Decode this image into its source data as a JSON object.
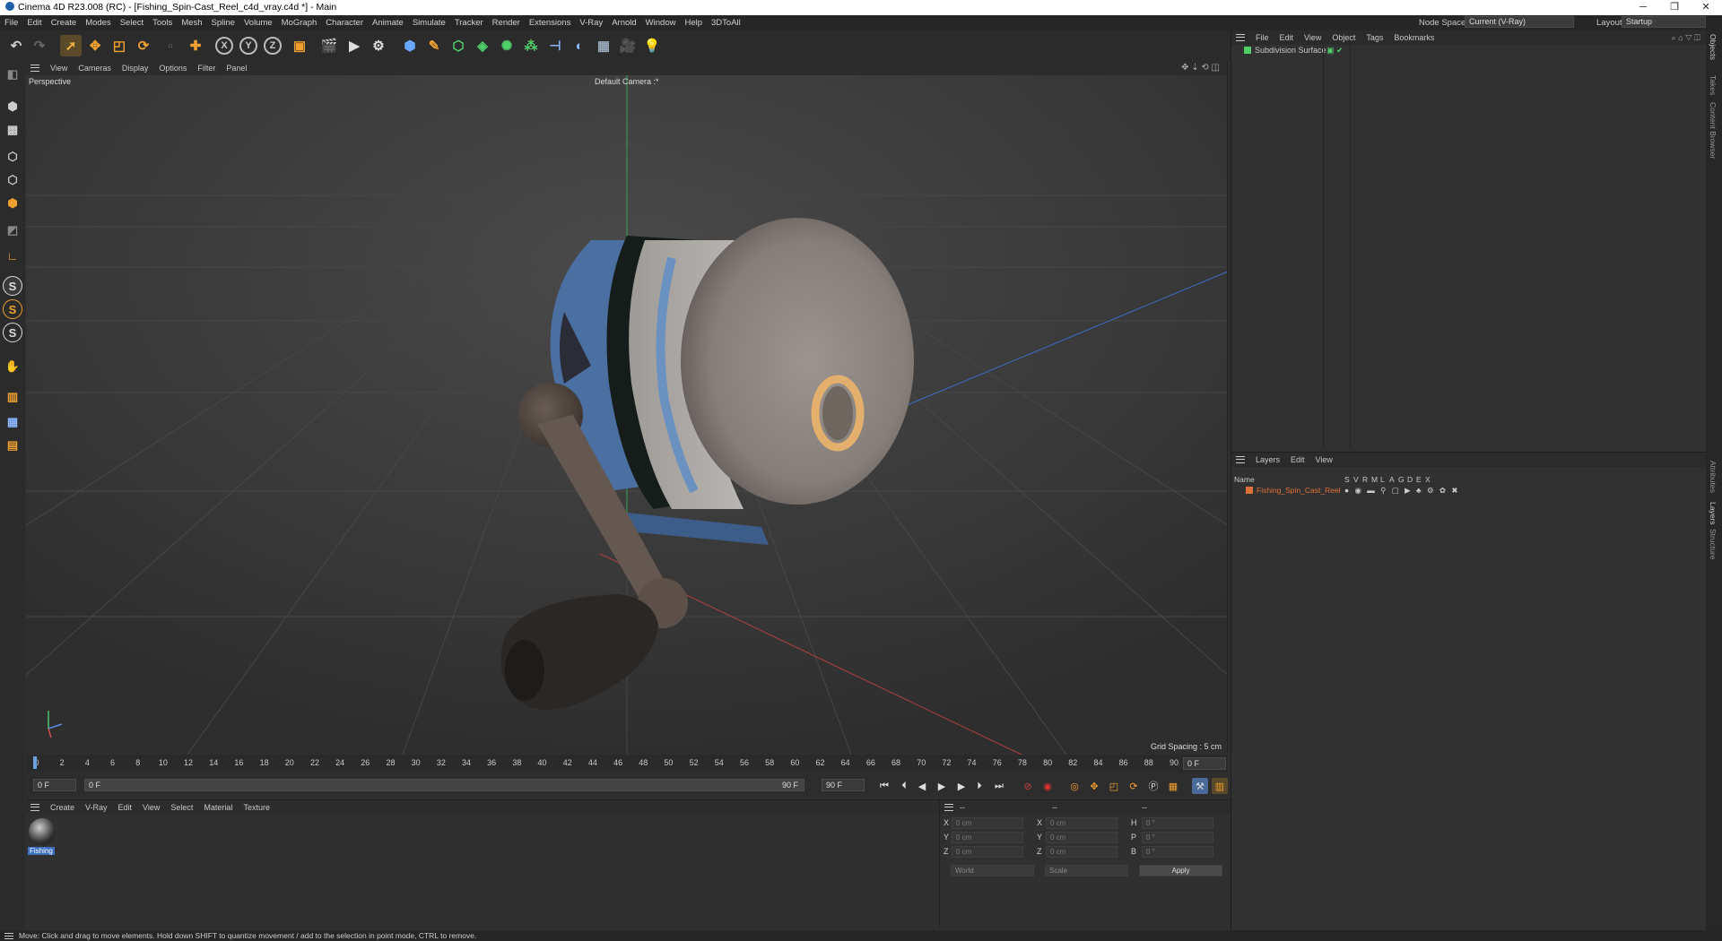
{
  "title": "Cinema 4D R23.008 (RC) - [Fishing_Spin-Cast_Reel_c4d_vray.c4d *] - Main",
  "window_controls": {
    "minimize": "─",
    "restore": "❐",
    "close": "✕"
  },
  "menu": [
    "File",
    "Edit",
    "Create",
    "Modes",
    "Select",
    "Tools",
    "Mesh",
    "Spline",
    "Volume",
    "MoGraph",
    "Character",
    "Animate",
    "Simulate",
    "Tracker",
    "Render",
    "Extensions",
    "V-Ray",
    "Arnold",
    "Window",
    "Help",
    "3DToAll"
  ],
  "node_space": {
    "label": "Node Space:",
    "value": "Current (V-Ray)"
  },
  "layout": {
    "label": "Layout:",
    "value": "Startup"
  },
  "toolbar": {
    "axis_x": "X",
    "axis_y": "Y",
    "axis_z": "Z"
  },
  "left_toolbar": {
    "s1": "S",
    "s2": "S",
    "s3": "S"
  },
  "viewport": {
    "menu": [
      "View",
      "Cameras",
      "Display",
      "Options",
      "Filter",
      "Panel"
    ],
    "label": "Perspective",
    "camera": "Default Camera :*",
    "grid_spacing": "Grid Spacing : 5 cm"
  },
  "timeline": {
    "ticks": [
      "0",
      "2",
      "4",
      "6",
      "8",
      "10",
      "12",
      "14",
      "16",
      "18",
      "20",
      "22",
      "24",
      "26",
      "28",
      "30",
      "32",
      "34",
      "36",
      "38",
      "40",
      "42",
      "44",
      "46",
      "48",
      "50",
      "52",
      "54",
      "56",
      "58",
      "60",
      "62",
      "64",
      "66",
      "68",
      "70",
      "72",
      "74",
      "76",
      "78",
      "80",
      "82",
      "84",
      "86",
      "88",
      "90"
    ],
    "end_field": "0 F"
  },
  "playback": {
    "current": "0 F",
    "start": "0 F",
    "end": "90 F",
    "end2": "90 F"
  },
  "material_panel": {
    "menu": [
      "Create",
      "V-Ray",
      "Edit",
      "View",
      "Select",
      "Material",
      "Texture"
    ],
    "material_name": "Fishing"
  },
  "coords": {
    "header1": "--",
    "header2": "--",
    "header3": "--",
    "x": "X",
    "y": "Y",
    "z": "Z",
    "x2": "X",
    "y2": "Y",
    "z2": "Z",
    "h": "H",
    "p": "P",
    "b": "B",
    "val_cm": "0 cm",
    "val_deg": "0 °",
    "mode1": "World",
    "mode2": "Scale",
    "apply": "Apply"
  },
  "objects_panel": {
    "menu": [
      "File",
      "Edit",
      "View",
      "Object",
      "Tags",
      "Bookmarks"
    ],
    "item": "Subdivision Surface"
  },
  "layers_panel": {
    "menu": [
      "Layers",
      "Edit",
      "View"
    ],
    "name_header": "Name",
    "flags": [
      "S",
      "V",
      "R",
      "M",
      "L",
      "A",
      "G",
      "D",
      "E",
      "X"
    ],
    "layer": "Fishing_Spin_Cast_Reel",
    "layer_color": "#e0703a"
  },
  "side_tabs": [
    "Objects",
    "Takes",
    "Content Browser",
    "Attributes",
    "Layers",
    "Structure"
  ],
  "status": "Move: Click and drag to move elements. Hold down SHIFT to quantize movement / add to the selection in point mode, CTRL to remove."
}
